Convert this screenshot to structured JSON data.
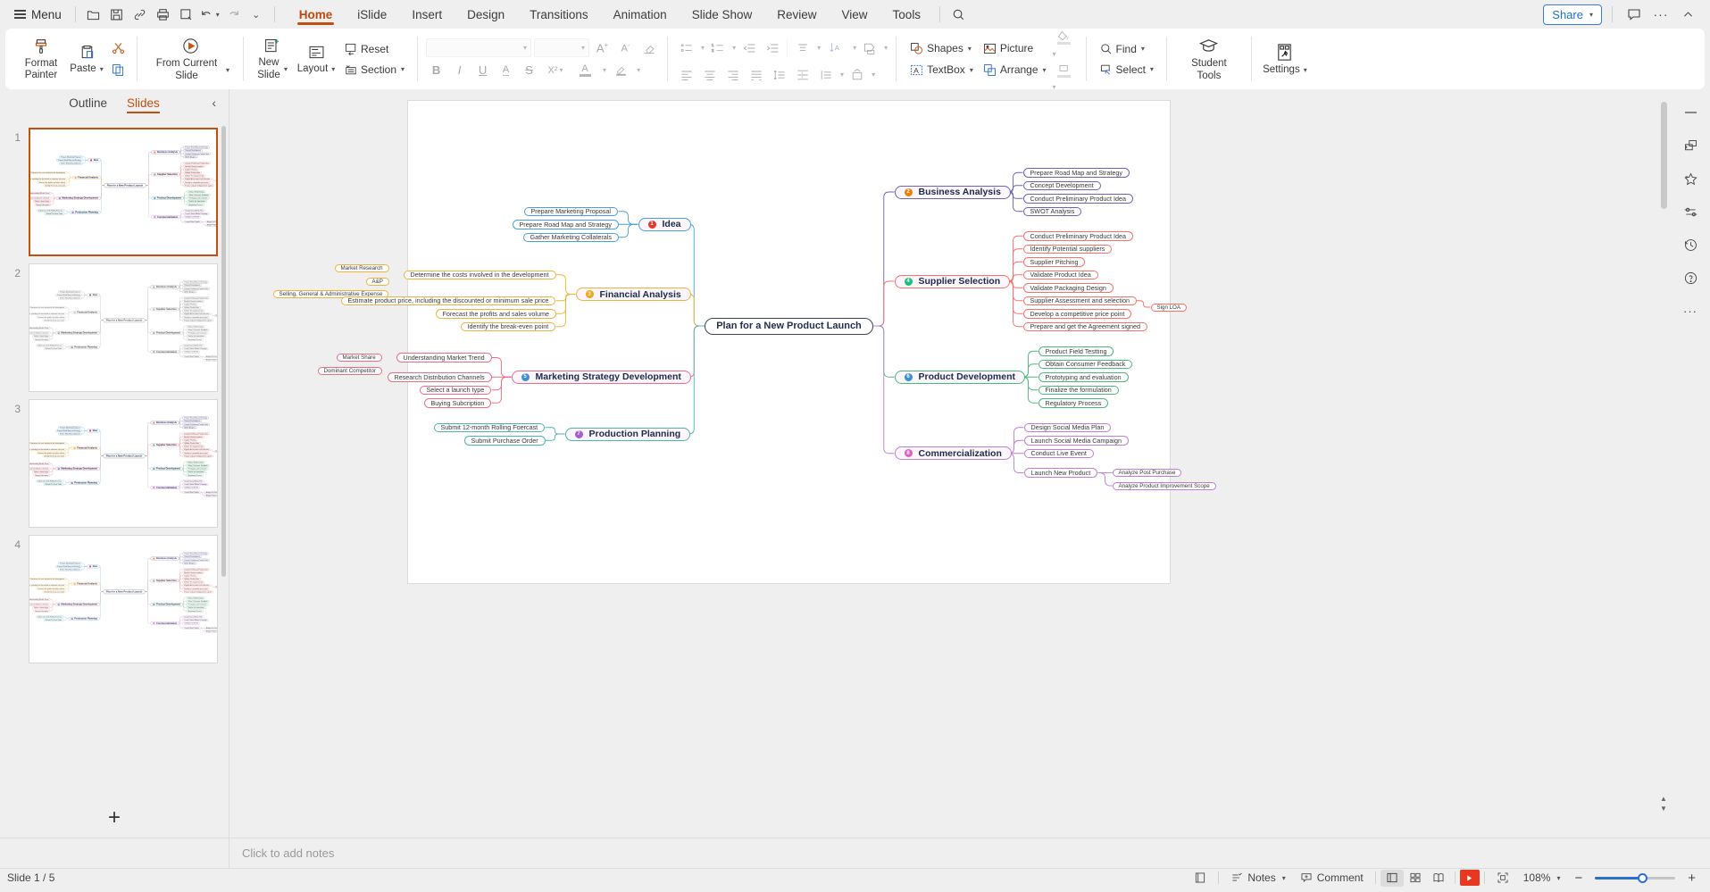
{
  "app": {
    "menu_label": "Menu",
    "quick_icons": [
      "open-folder-icon",
      "save-icon",
      "link-icon",
      "print-icon",
      "print-preview-icon",
      "undo-icon",
      "redo-icon",
      "more-quick-access-icon"
    ],
    "tabs": [
      {
        "label": "Home",
        "active": true
      },
      {
        "label": "iSlide",
        "active": false
      },
      {
        "label": "Insert",
        "active": false
      },
      {
        "label": "Design",
        "active": false
      },
      {
        "label": "Transitions",
        "active": false
      },
      {
        "label": "Animation",
        "active": false
      },
      {
        "label": "Slide Show",
        "active": false
      },
      {
        "label": "Review",
        "active": false
      },
      {
        "label": "View",
        "active": false
      },
      {
        "label": "Tools",
        "active": false
      }
    ],
    "search_icon": "search-icon",
    "share_label": "Share",
    "comment_icon": "comment-icon",
    "more_icon": "ellipsis-icon",
    "collapse_ribbon_icon": "chevron-up-icon"
  },
  "ribbon": {
    "format_painter": "Format Painter",
    "paste": "Paste",
    "cut_icon": "scissors-icon",
    "copy_icon": "copy-icon",
    "from_current_slide": "From Current Slide",
    "new_slide": "New Slide",
    "layout": "Layout",
    "reset": "Reset",
    "section": "Section",
    "font_name": "",
    "font_size": "",
    "grow_font_icon": "increase-font-size-icon",
    "shrink_font_icon": "decrease-font-size-icon",
    "clear_format_icon": "clear-formatting-icon",
    "bold": "B",
    "italic": "I",
    "underline": "U",
    "text_shadow": "A",
    "strikethrough": "S",
    "superscript": "X²",
    "font_color": "A",
    "highlight": "highlight-icon",
    "shapes": "Shapes",
    "picture": "Picture",
    "textbox": "TextBox",
    "arrange": "Arrange",
    "find": "Find",
    "select": "Select",
    "student_tools": "Student Tools",
    "settings": "Settings"
  },
  "left_panel": {
    "tabs": [
      {
        "label": "Outline",
        "active": false
      },
      {
        "label": "Slides",
        "active": true
      }
    ],
    "collapse_icon": "chevron-left-icon",
    "slides": [
      {
        "number": "1",
        "selected": true
      },
      {
        "number": "2",
        "selected": false
      },
      {
        "number": "3",
        "selected": false
      },
      {
        "number": "4",
        "selected": false
      }
    ],
    "add_slide_icon": "plus-icon"
  },
  "right_rail": {
    "icons": [
      "panel-handle-icon",
      "duplicate-shape-icon",
      "favorites-star-icon",
      "adjust-sliders-icon",
      "history-clock-icon",
      "help-question-icon",
      "more-options-icon"
    ]
  },
  "notes": {
    "placeholder": "Click to add notes"
  },
  "status": {
    "slide_counter": "Slide 1 / 5",
    "fit_icon": "fit-slide-icon",
    "notes_label": "Notes",
    "comment_label": "Comment",
    "view_normal_icon": "normal-view-icon",
    "view_sorter_icon": "slide-sorter-icon",
    "view_reading_icon": "reading-view-icon",
    "play_icon": "play-slideshow-icon",
    "fullscreen_icon": "fullscreen-icon",
    "zoom_level": "108%",
    "zoom_out_icon": "zoom-out-icon",
    "zoom_in_icon": "zoom-in-icon"
  },
  "colors": {
    "accent": "#c0500f",
    "idea": "#4a9fd8",
    "financial": "#efb33c",
    "marketing": "#ef6d84",
    "production": "#4fb3ae",
    "business": "#6c63b5",
    "supplier": "#f4726a",
    "product_dev": "#4cb87e",
    "commercial": "#c07ed4",
    "root_border": "#3a4358",
    "share": "#1a73c7"
  },
  "mindmap": {
    "root": "Plan for a New Product Launch",
    "left_branches": [
      {
        "id": "idea",
        "label": "Idea",
        "badge": "1",
        "color": "#4a9fd8",
        "badge_color": "#e03a2f",
        "children": [
          {
            "label": "Prepare Marketing Proposal",
            "children": []
          },
          {
            "label": "Prepare Road Map and Strategy",
            "children": []
          },
          {
            "label": "Gather Marketing Collaterals",
            "children": []
          }
        ]
      },
      {
        "id": "financial",
        "label": "Financial Analysis",
        "badge": "3",
        "color": "#efb33c",
        "badge_color": "#f0a818",
        "children": [
          {
            "label": "Determine the costs involved in the development",
            "children": [
              {
                "label": "Market Research"
              },
              {
                "label": "A&P"
              },
              {
                "label": "Selling, General & Administrative Expense"
              }
            ]
          },
          {
            "label": "Estimate product price, including the discounted or minimum sale price",
            "children": []
          },
          {
            "label": "Forecast the profits and sales volume",
            "children": []
          },
          {
            "label": "Identify the break-even point",
            "children": []
          }
        ]
      },
      {
        "id": "marketing",
        "label": "Marketing Strategy Development",
        "badge": "5",
        "color": "#ef6d84",
        "badge_color": "#3a8fd8",
        "children": [
          {
            "label": "Understanding Market Trend",
            "children": [
              {
                "label": "Market Share"
              },
              {
                "label": "Dominant Competitor"
              }
            ]
          },
          {
            "label": "Research Distribution Channels",
            "children": []
          },
          {
            "label": "Select a launch type",
            "children": []
          },
          {
            "label": "Buying Subcription",
            "children": []
          }
        ]
      },
      {
        "id": "production",
        "label": "Production Planning",
        "badge": "7",
        "color": "#4fb3ae",
        "badge_color": "#a25fd0",
        "children": [
          {
            "label": "Submit 12-month Rolling Foercast",
            "children": []
          },
          {
            "label": "Submit Purchase Order",
            "children": []
          }
        ]
      }
    ],
    "right_branches": [
      {
        "id": "business",
        "label": "Business Analysis",
        "badge": "2",
        "color": "#6c63b5",
        "badge_color": "#f08000",
        "children": [
          {
            "label": "Prepare Road Map and Strategy",
            "children": []
          },
          {
            "label": "Concept Development",
            "children": []
          },
          {
            "label": "Conduct Preliminary Product Idea",
            "children": []
          },
          {
            "label": "SWOT Analysis",
            "children": []
          }
        ]
      },
      {
        "id": "supplier",
        "label": "Supplier Selection",
        "badge": "4",
        "color": "#f4726a",
        "badge_color": "#19c37d",
        "children": [
          {
            "label": "Conduct Preliminary Product Idea",
            "children": []
          },
          {
            "label": "Identify Potential suppliers",
            "children": []
          },
          {
            "label": "Supplier Pitching",
            "children": []
          },
          {
            "label": "Validate Product Idea",
            "children": []
          },
          {
            "label": "Validate Packaging Design",
            "children": []
          },
          {
            "label": "Supplier Assessment and selection",
            "children": [
              {
                "label": "Sign LOA"
              }
            ]
          },
          {
            "label": "Develop a competitive price point",
            "children": []
          },
          {
            "label": "Prepare and get the Agreement signed",
            "children": []
          }
        ]
      },
      {
        "id": "productdev",
        "label": "Product Development",
        "badge": "6",
        "color": "#4cb87e",
        "badge_color": "#3a8fd8",
        "children": [
          {
            "label": "Product Field Testting",
            "children": []
          },
          {
            "label": "Obtain Consumer Feedback",
            "children": []
          },
          {
            "label": "Prototyping and evaluation",
            "children": []
          },
          {
            "label": "Finalize the formulation",
            "children": []
          },
          {
            "label": "Regulatory Process",
            "children": []
          }
        ]
      },
      {
        "id": "commercial",
        "label": "Commercialization",
        "badge": "8",
        "color": "#c07ed4",
        "badge_color": "#e060c0",
        "children": [
          {
            "label": "Design Social Media Plan",
            "children": []
          },
          {
            "label": "Launch Social Media Campaign",
            "children": []
          },
          {
            "label": "Conduct Live Event",
            "children": []
          },
          {
            "label": "Launch New Product",
            "children": [
              {
                "label": "Analyze Post Purchase"
              },
              {
                "label": "Analyze Product Improvement Scope"
              }
            ]
          }
        ]
      }
    ]
  }
}
